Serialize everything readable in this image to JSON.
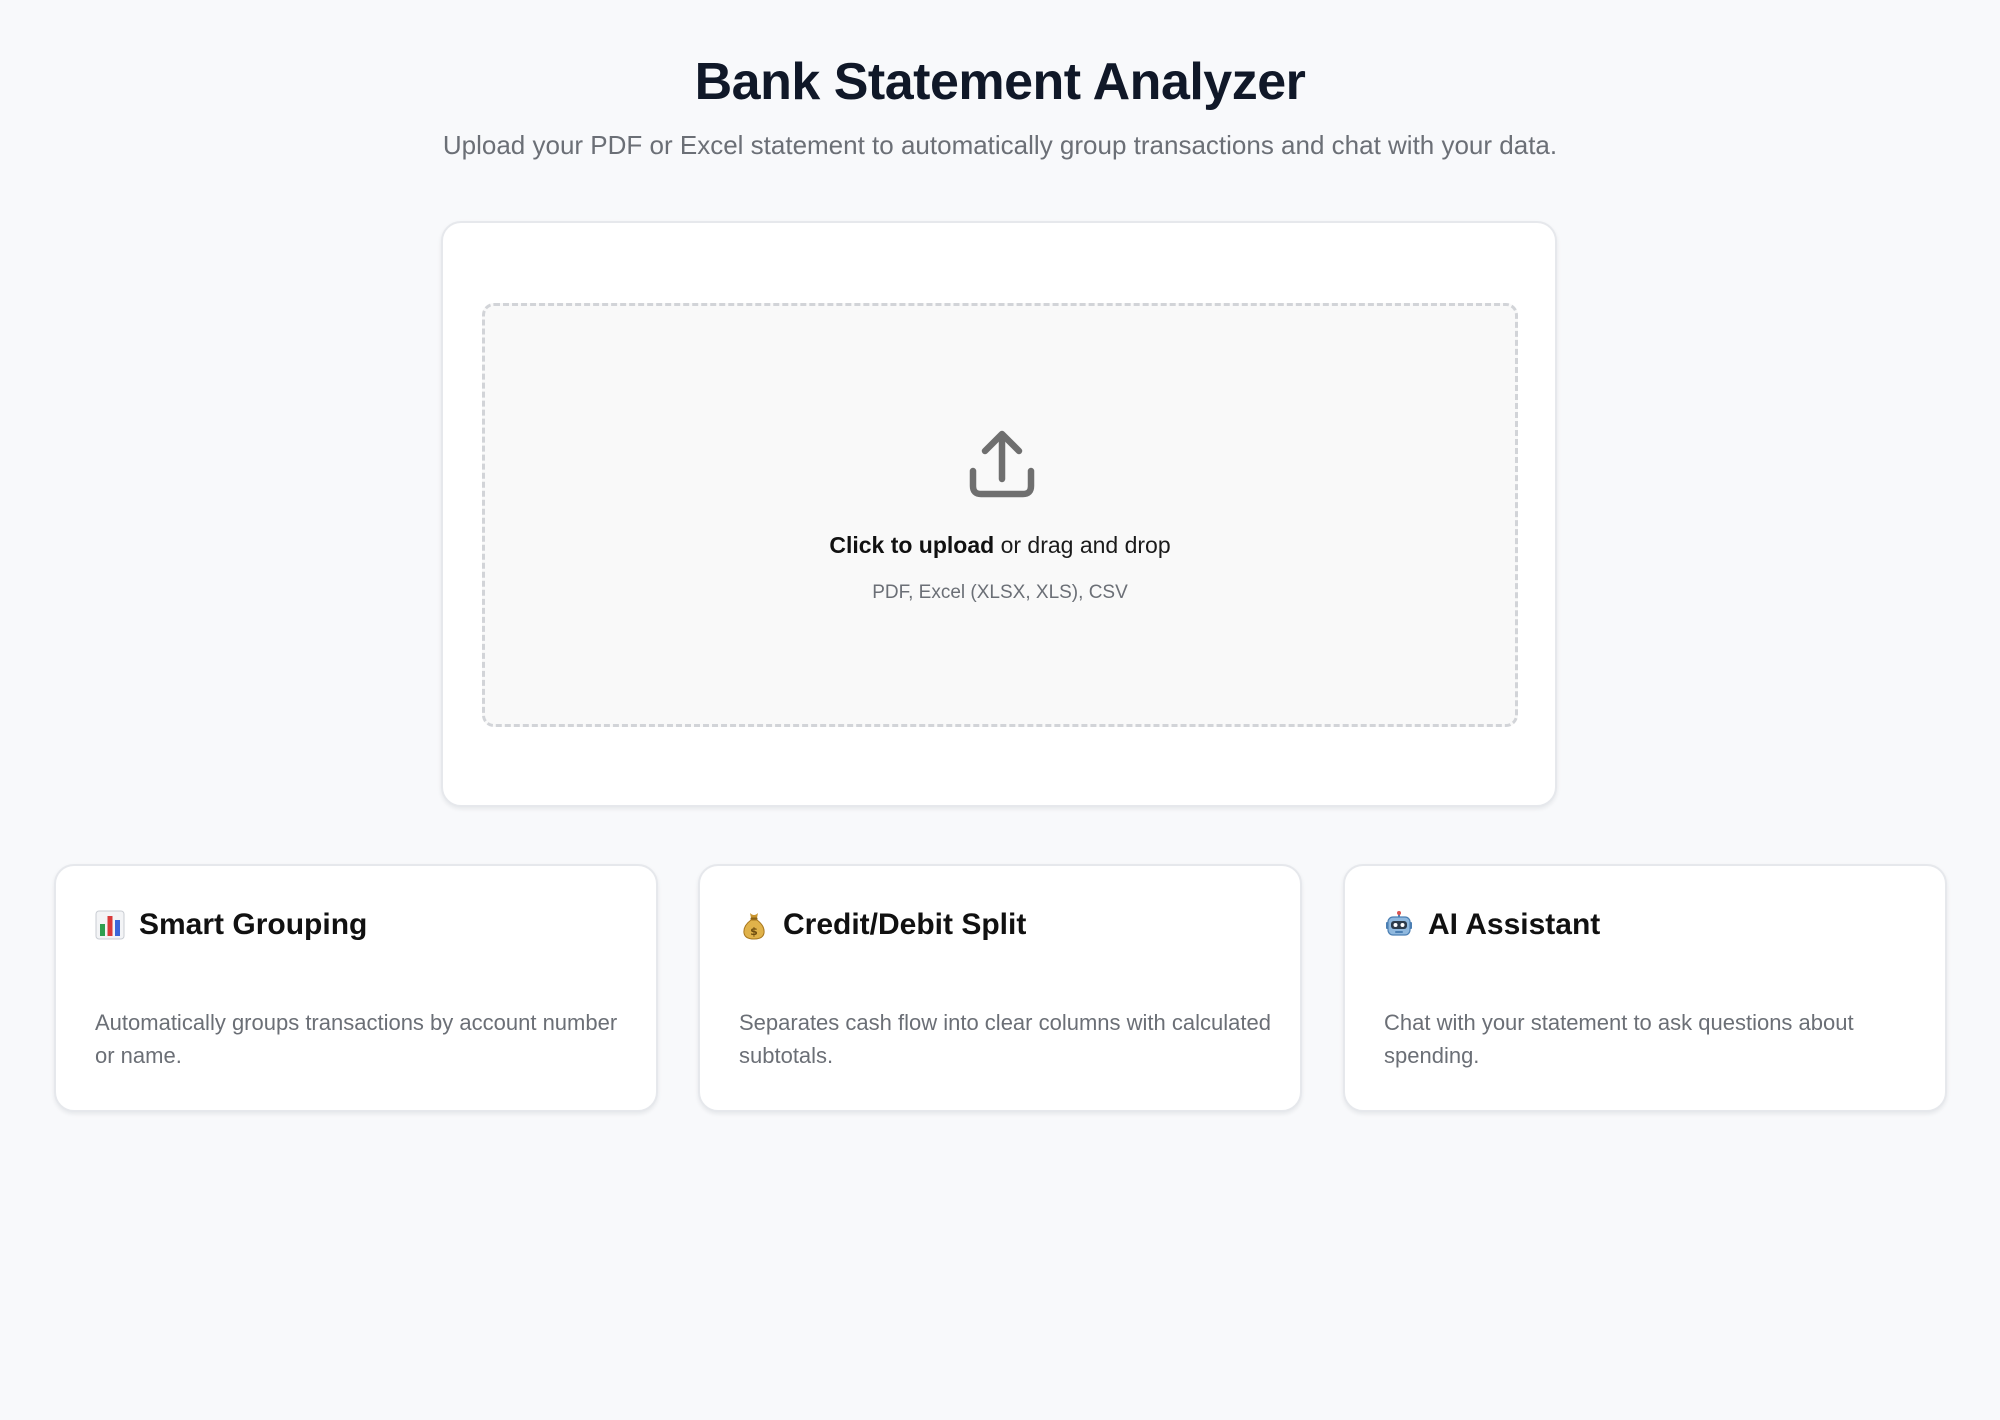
{
  "header": {
    "title": "Bank Statement Analyzer",
    "subtitle": "Upload your PDF or Excel statement to automatically group transactions and chat with your data."
  },
  "upload": {
    "icon": "upload-icon",
    "click_label": "Click to upload",
    "drag_label": " or drag and drop",
    "formats": "PDF, Excel (XLSX, XLS), CSV"
  },
  "features": [
    {
      "icon": "bar-chart-icon",
      "title": "Smart Grouping",
      "description": "Automatically groups transactions by account number or name."
    },
    {
      "icon": "money-bag-icon",
      "title": "Credit/Debit Split",
      "description": "Separates cash flow into clear columns with calculated subtotals."
    },
    {
      "icon": "robot-icon",
      "title": "AI Assistant",
      "description": "Chat with your statement to ask questions about spending."
    }
  ],
  "colors": {
    "background": "#f8f9fb",
    "title": "#101828",
    "muted_text": "#6b6f76",
    "card_border": "#e6e8ec",
    "dropzone_border": "#d2d4d8"
  }
}
